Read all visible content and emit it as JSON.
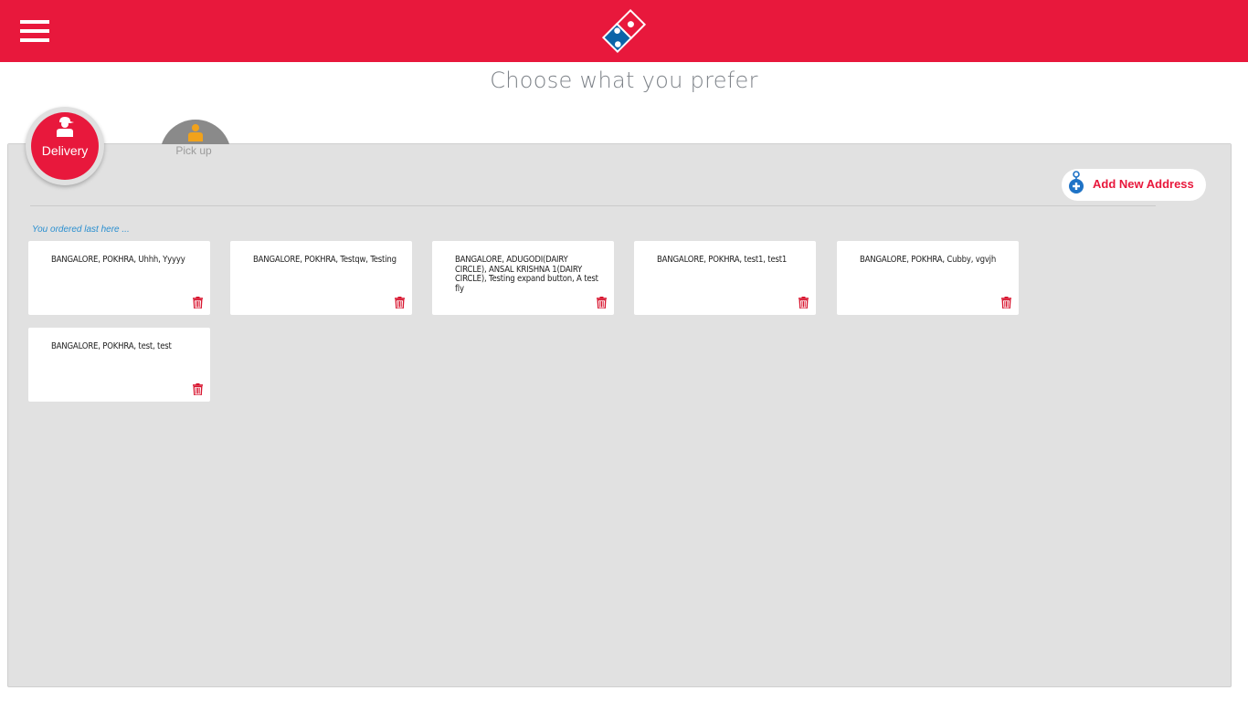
{
  "header": {
    "menu_icon": "hamburger-menu-icon",
    "logo_icon": "dominos-logo-icon",
    "brand_color": "#e8183c"
  },
  "page_title": "Choose what you prefer",
  "tabs": [
    {
      "label": "Delivery",
      "icon": "delivery-person-icon",
      "active": true
    },
    {
      "label": "Pick up",
      "icon": "pickup-person-icon",
      "active": false
    }
  ],
  "add_address": {
    "label": "Add New Address",
    "icon": "location-plus-icon"
  },
  "section_label": "You ordered last here ...",
  "addresses": [
    {
      "text": "BANGALORE, POKHRA, Uhhh, Yyyyy",
      "icon": "trash-icon"
    },
    {
      "text": "BANGALORE, POKHRA, Testqw, Testing",
      "icon": "trash-icon"
    },
    {
      "text": "BANGALORE, ADUGODI(DAIRY CIRCLE), ANSAL KRISHNA 1(DAIRY CIRCLE), Testing expand button, A test fly",
      "icon": "trash-icon"
    },
    {
      "text": "BANGALORE, POKHRA, test1, test1",
      "icon": "trash-icon"
    },
    {
      "text": "BANGALORE, POKHRA, Cubby, vgvjh",
      "icon": "trash-icon"
    },
    {
      "text": "BANGALORE, POKHRA, test, test",
      "icon": "trash-icon"
    }
  ]
}
